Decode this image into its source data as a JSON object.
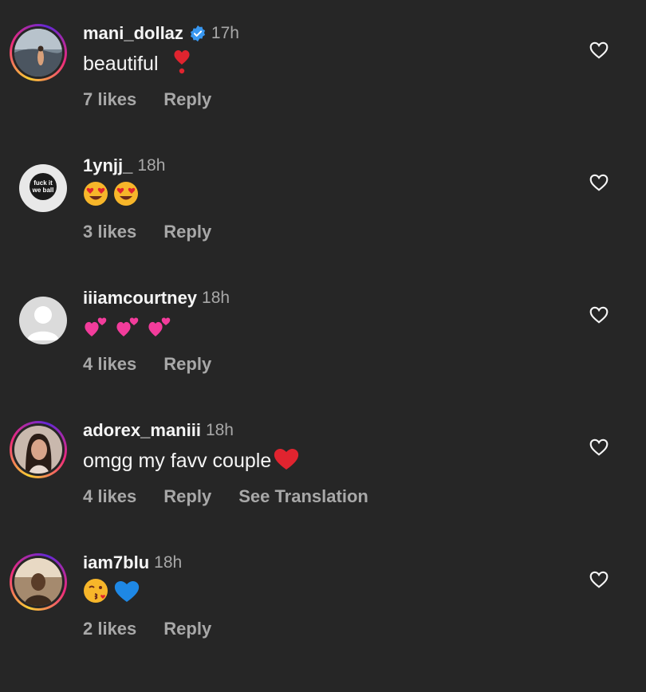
{
  "comments": [
    {
      "username": "mani_dollaz",
      "verified": true,
      "time": "17h",
      "text": "beautiful ",
      "likes": "7 likes",
      "reply": "Reply"
    },
    {
      "username": "1ynjj_",
      "verified": false,
      "time": "18h",
      "text": "",
      "likes": "3 likes",
      "reply": "Reply",
      "avatar_text": "fuck it we ball"
    },
    {
      "username": "iiiamcourtney",
      "verified": false,
      "time": "18h",
      "text": "",
      "likes": "4 likes",
      "reply": "Reply"
    },
    {
      "username": "adorex_maniii",
      "verified": false,
      "time": "18h",
      "text": "omgg my favv couple",
      "likes": "4 likes",
      "reply": "Reply",
      "translation": "See Translation"
    },
    {
      "username": "iam7blu",
      "verified": false,
      "time": "18h",
      "text": "",
      "likes": "2 likes",
      "reply": "Reply"
    }
  ],
  "colors": {
    "background": "#262626",
    "primary_text": "#f5f5f5",
    "secondary_text": "#a8a8a8",
    "verified_blue": "#3897f0"
  },
  "icons": [
    "heart-outline-icon",
    "verified-badge-icon"
  ]
}
